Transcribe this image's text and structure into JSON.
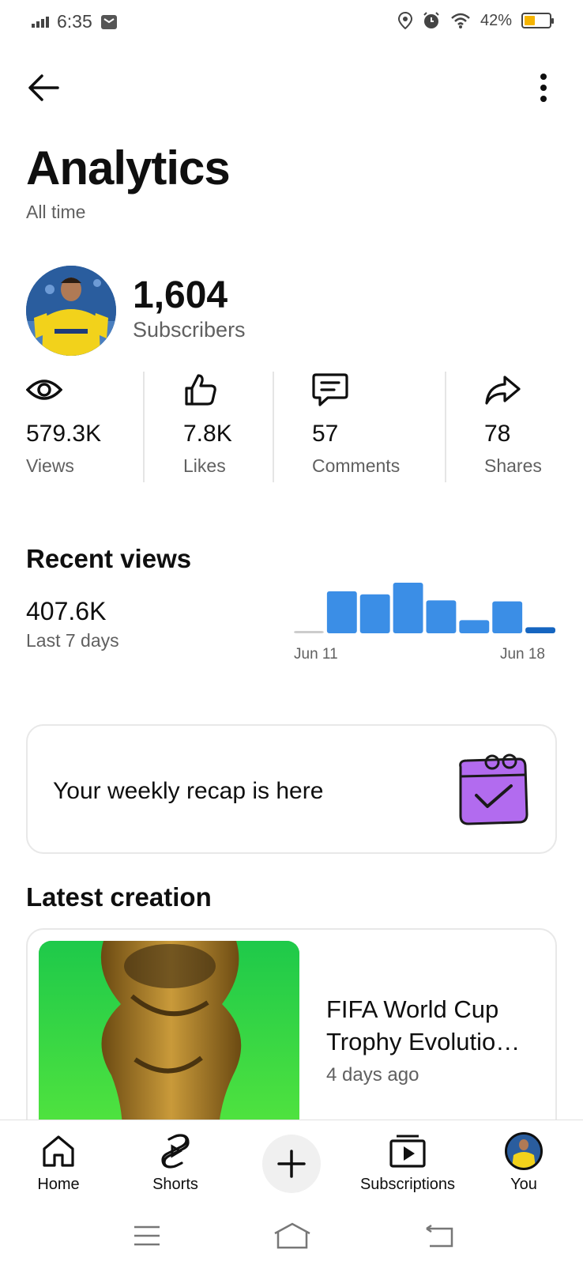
{
  "status_bar": {
    "time": "6:35",
    "battery": "42%",
    "battery_level": 0.42
  },
  "header": {
    "title": "Analytics",
    "subtitle": "All time"
  },
  "channel": {
    "subscribers": "1,604",
    "subscribers_label": "Subscribers"
  },
  "stats": [
    {
      "value": "579.3K",
      "label": "Views",
      "icon": "eye-icon"
    },
    {
      "value": "7.8K",
      "label": "Likes",
      "icon": "thumbs-up-icon"
    },
    {
      "value": "57",
      "label": "Comments",
      "icon": "comment-icon"
    },
    {
      "value": "78",
      "label": "Shares",
      "icon": "share-icon"
    }
  ],
  "recent_views": {
    "title": "Recent views",
    "value": "407.6K",
    "period": "Last 7 days",
    "x_start": "Jun 11",
    "x_end": "Jun 18"
  },
  "chart_data": {
    "type": "bar",
    "title": "",
    "xlabel": "",
    "ylabel": "",
    "categories": [
      "Jun 11",
      "",
      "",
      "",
      "",
      "",
      "",
      "Jun 18"
    ],
    "values": [
      0.04,
      0.83,
      0.77,
      1.0,
      0.65,
      0.26,
      0.63,
      0.12
    ],
    "colors": [
      "#cccccc",
      "#3b8ee6",
      "#3b8ee6",
      "#3b8ee6",
      "#3b8ee6",
      "#3b8ee6",
      "#3b8ee6",
      "#1565c0"
    ]
  },
  "recap": {
    "text": "Your weekly recap is here",
    "icon": "calendar-check-icon"
  },
  "latest_creation": {
    "title": "Latest creation",
    "video_title_line1": "FIFA World Cup",
    "video_title_line2": "Trophy Evolutio…",
    "age": "4 days ago"
  },
  "bottom_nav": {
    "home": "Home",
    "shorts": "Shorts",
    "subscriptions": "Subscriptions",
    "you": "You"
  },
  "colors": {
    "accent": "#3b8ee6",
    "accent_dark": "#1565c0",
    "recap_purple": "#b26bef"
  }
}
